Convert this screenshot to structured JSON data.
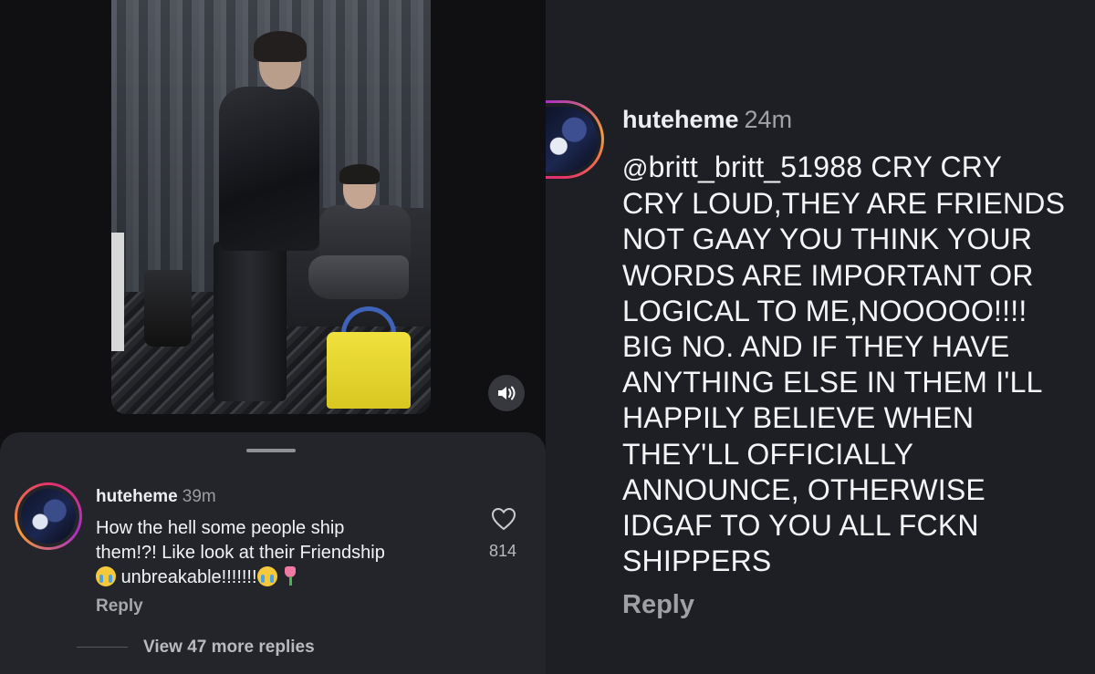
{
  "left_panel": {
    "media": {
      "mute_icon": "speaker-icon"
    },
    "comment": {
      "username": "huteheme",
      "time": "39m",
      "text_line1": "How the hell some people ship",
      "text_line2": "them!?! Like look at their Friendship",
      "text_line3": "unbreakable!!!!!!!",
      "emojis": [
        "loudly-crying-face",
        "loudly-crying-face",
        "tulip"
      ],
      "reply_label": "Reply",
      "like_icon": "heart-icon",
      "like_count": "814"
    },
    "view_more_label": "View 47 more replies"
  },
  "right_panel": {
    "comment": {
      "username": "huteheme",
      "time": "24m",
      "mention": "britt_britt_51988",
      "mention_symbol": "@",
      "text_lines": [
        "CRY CRY",
        "CRY LOUD,THEY ARE FRIENDS",
        "NOT GAAY YOU THINK YOUR",
        "WORDS ARE IMPORTANT OR",
        "LOGICAL TO ME,NOOOOO!!!!",
        "BIG NO. AND IF THEY HAVE",
        "ANYTHING ELSE IN THEM I'LL",
        "HAPPILY BELIEVE WHEN",
        "THEY'LL OFFICIALLY",
        "ANNOUNCE, OTHERWISE",
        "IDGAF TO YOU ALL FCKN",
        "SHIPPERS"
      ],
      "reply_label": "Reply"
    }
  },
  "colors": {
    "story_ring_start": "#e5326a",
    "story_ring_mid": "#a92fc2",
    "story_ring_end": "#f59d3a",
    "bag_yellow": "#f1e13e",
    "bag_handle_blue": "#3f63b8"
  }
}
